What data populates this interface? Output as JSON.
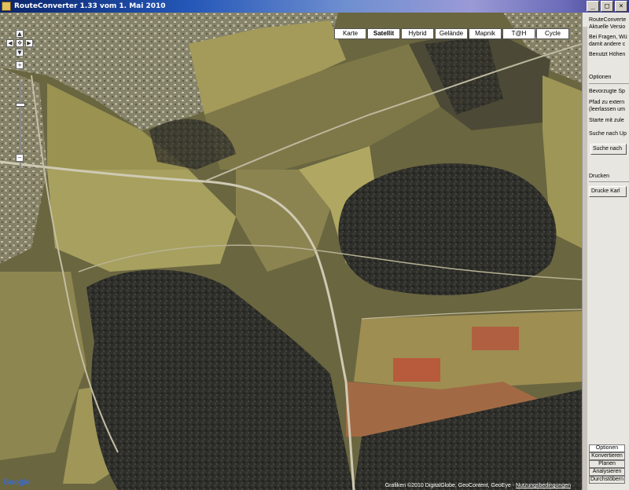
{
  "window": {
    "title": "RouteConverter 1.33 vom 1. Mai 2010",
    "minimize": "_",
    "maximize": "□",
    "close": "×"
  },
  "map": {
    "map_types": [
      "Karte",
      "Satellit",
      "Hybrid",
      "Gelände",
      "Mapnik",
      "T@H",
      "Cycle"
    ],
    "active_map_type": "Satellit",
    "copyright_prefix": "Grafiken ©2010 DigitalGlobe, GeoContent, GeoEye - ",
    "copyright_link": "Nutzungsbedingungen",
    "logo": "Google"
  },
  "panel": {
    "lines": [
      "RouteConverte",
      "Aktuelle Versio",
      "Bei Fragen, Wü",
      "damit andere c",
      "Benutzt Höhen"
    ],
    "options_heading": "Optionen",
    "preferred": "Bevorzugte Sp",
    "path_label": "Pfad zu extern",
    "path_hint": "(leerlassen um",
    "start_with": "Starte mit zule",
    "search_updates": "Suche nach Up",
    "search_button": "Suche nach",
    "print_heading": "Drucken",
    "print_button": "Drucke Karl"
  },
  "tabs": [
    "Optionen",
    "Konvertieren",
    "Planen",
    "Analysieren",
    "Durchstöbern"
  ],
  "active_tab": "Optionen",
  "icons": {
    "pan-up": "arrow-up-icon",
    "pan-down": "arrow-down-icon",
    "pan-left": "arrow-left-icon",
    "pan-right": "arrow-right-icon",
    "center": "center-icon",
    "zoom-in": "plus-icon",
    "zoom-out": "minus-icon"
  },
  "colors": {
    "title_start": "#0a246a",
    "title_end": "#3a3a8a",
    "panel_bg": "#e8e6e0"
  }
}
